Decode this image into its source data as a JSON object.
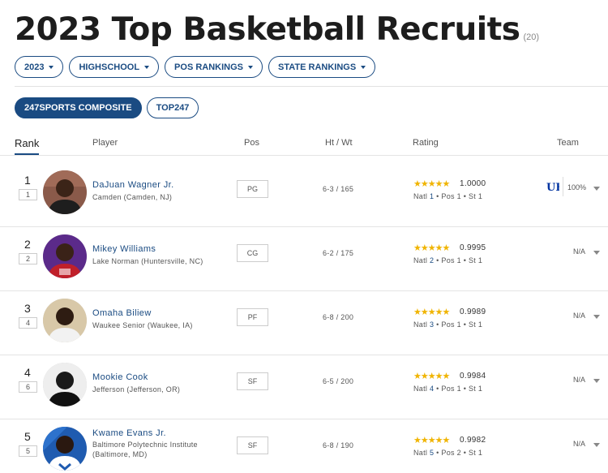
{
  "page": {
    "title": "2023 Top Basketball Recruits",
    "count": "(20)"
  },
  "filters": [
    {
      "label": "2023"
    },
    {
      "label": "HIGHSCHOOL"
    },
    {
      "label": "POS RANKINGS"
    },
    {
      "label": "STATE RANKINGS"
    }
  ],
  "tabs": [
    {
      "label": "247SPORTS COMPOSITE",
      "active": true
    },
    {
      "label": "TOP247",
      "active": false
    }
  ],
  "headers": {
    "rank": "Rank",
    "player": "Player",
    "pos": "Pos",
    "htwt": "Ht / Wt",
    "rating": "Rating",
    "team": "Team"
  },
  "players": [
    {
      "rank": "1",
      "sub_rank": "1",
      "name": "DaJuan Wagner Jr.",
      "school": "Camden (Camden, NJ)",
      "pos": "PG",
      "htwt": "6-3 / 165",
      "stars": "★★★★★",
      "rating": "1.0000",
      "natl_label": "Natl",
      "natl": "1",
      "pos_rank": "Pos 1",
      "st_rank": "St 1",
      "team": "100%",
      "team_logo": "kentucky-logo-icon"
    },
    {
      "rank": "2",
      "sub_rank": "2",
      "name": "Mikey Williams",
      "school": "Lake Norman (Huntersville, NC)",
      "pos": "CG",
      "htwt": "6-2 / 175",
      "stars": "★★★★★",
      "rating": "0.9995",
      "natl_label": "Natl",
      "natl": "2",
      "pos_rank": "Pos 1",
      "st_rank": "St 1",
      "team": "N/A"
    },
    {
      "rank": "3",
      "sub_rank": "4",
      "name": "Omaha Biliew",
      "school": "Waukee Senior (Waukee, IA)",
      "pos": "PF",
      "htwt": "6-8 / 200",
      "stars": "★★★★★",
      "rating": "0.9989",
      "natl_label": "Natl",
      "natl": "3",
      "pos_rank": "Pos 1",
      "st_rank": "St 1",
      "team": "N/A"
    },
    {
      "rank": "4",
      "sub_rank": "6",
      "name": "Mookie Cook",
      "school": "Jefferson (Jefferson, OR)",
      "pos": "SF",
      "htwt": "6-5 / 200",
      "stars": "★★★★★",
      "rating": "0.9984",
      "natl_label": "Natl",
      "natl": "4",
      "pos_rank": "Pos 1",
      "st_rank": "St 1",
      "team": "N/A"
    },
    {
      "rank": "5",
      "sub_rank": "5",
      "name": "Kwame Evans Jr.",
      "school": "Baltimore Polytechnic Institute (Baltimore, MD)",
      "pos": "SF",
      "htwt": "6-8 / 190",
      "stars": "★★★★★",
      "rating": "0.9982",
      "natl_label": "Natl",
      "natl": "5",
      "pos_rank": "Pos 2",
      "st_rank": "St 1",
      "team": "N/A"
    }
  ],
  "colors": {
    "accent": "#1a4b82",
    "star": "#f0b400"
  }
}
